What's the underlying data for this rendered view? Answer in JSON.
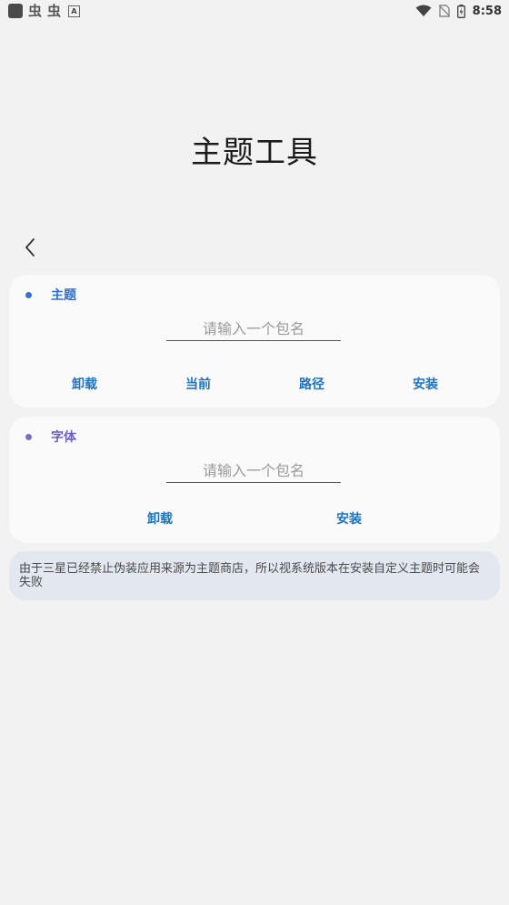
{
  "status_bar": {
    "time": "8:58",
    "bug_glyph_1": "虫",
    "bug_glyph_2": "虫",
    "a_icon_letter": "A"
  },
  "page": {
    "title": "主题工具"
  },
  "theme_card": {
    "title": "主题",
    "dot_color": "#3a6fd8",
    "title_color": "#2f6fd6",
    "input_value": "",
    "input_placeholder": "请输入一个包名",
    "buttons": {
      "uninstall": "卸载",
      "current": "当前",
      "path": "路径",
      "install": "安装"
    }
  },
  "font_card": {
    "title": "字体",
    "dot_color": "#7a6fc4",
    "title_color": "#6c5fbf",
    "input_value": "",
    "input_placeholder": "请输入一个包名",
    "buttons": {
      "uninstall": "卸载",
      "install": "安装"
    }
  },
  "notice": {
    "text": "由于三星已经禁止伪装应用来源为主题商店，所以视系统版本在安装自定义主题时可能会失败"
  },
  "colors": {
    "accent": "#1e73c4",
    "background": "#f2f2f2",
    "card": "#fafafa",
    "notice_bg": "#e3e8f0"
  }
}
